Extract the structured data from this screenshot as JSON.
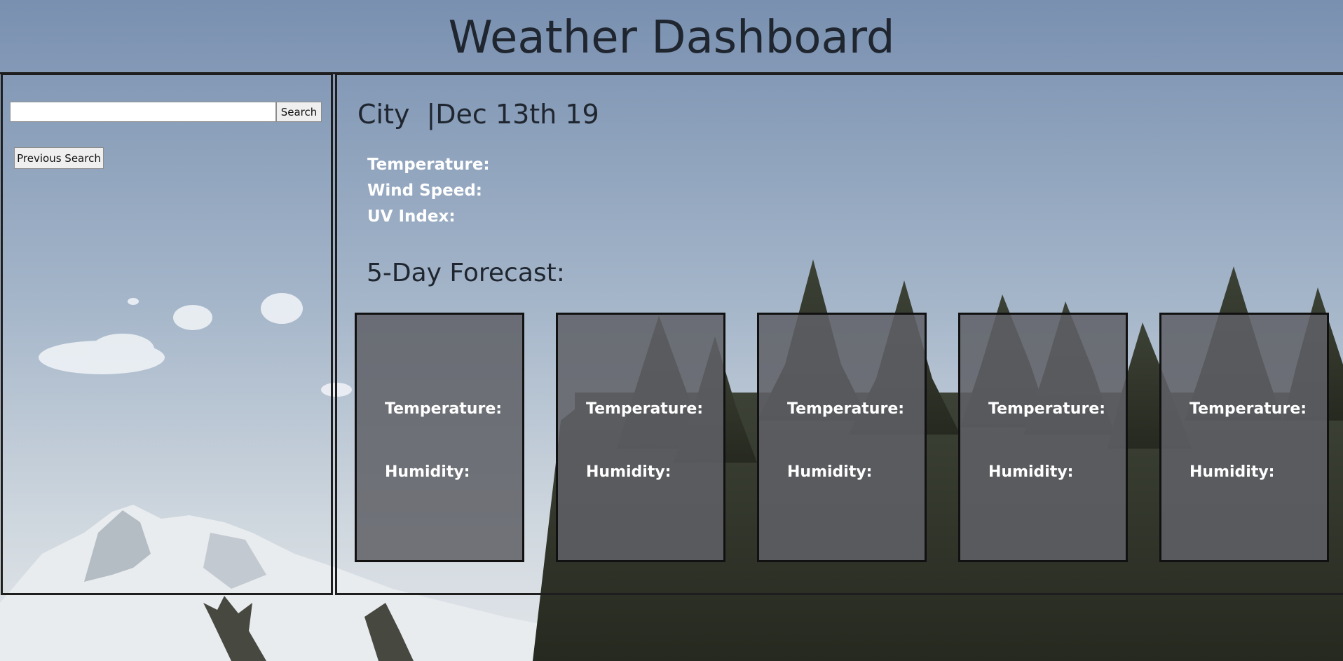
{
  "header": {
    "title": "Weather Dashboard"
  },
  "sidebar": {
    "search": {
      "value": "",
      "placeholder": "",
      "button_label": "Search"
    },
    "previous_search_label": "Previous Search"
  },
  "current": {
    "city": "City",
    "separator": "|",
    "date": "Dec 13th 19",
    "temperature_label": "Temperature:",
    "wind_speed_label": "Wind Speed:",
    "uv_index_label": "UV Index:"
  },
  "forecast": {
    "title": "5-Day Forecast:",
    "cards": [
      {
        "temperature_label": "Temperature:",
        "humidity_label": "Humidity:"
      },
      {
        "temperature_label": "Temperature:",
        "humidity_label": "Humidity:"
      },
      {
        "temperature_label": "Temperature:",
        "humidity_label": "Humidity:"
      },
      {
        "temperature_label": "Temperature:",
        "humidity_label": "Humidity:"
      },
      {
        "temperature_label": "Temperature:",
        "humidity_label": "Humidity:"
      }
    ]
  },
  "colors": {
    "sky_top": "#7a91b1",
    "sky_bottom": "#c9d3dc",
    "heading_text": "#1f2630",
    "card_fill": "#5f6166",
    "border": "#1e1e1e",
    "label_text": "#ffffff"
  }
}
